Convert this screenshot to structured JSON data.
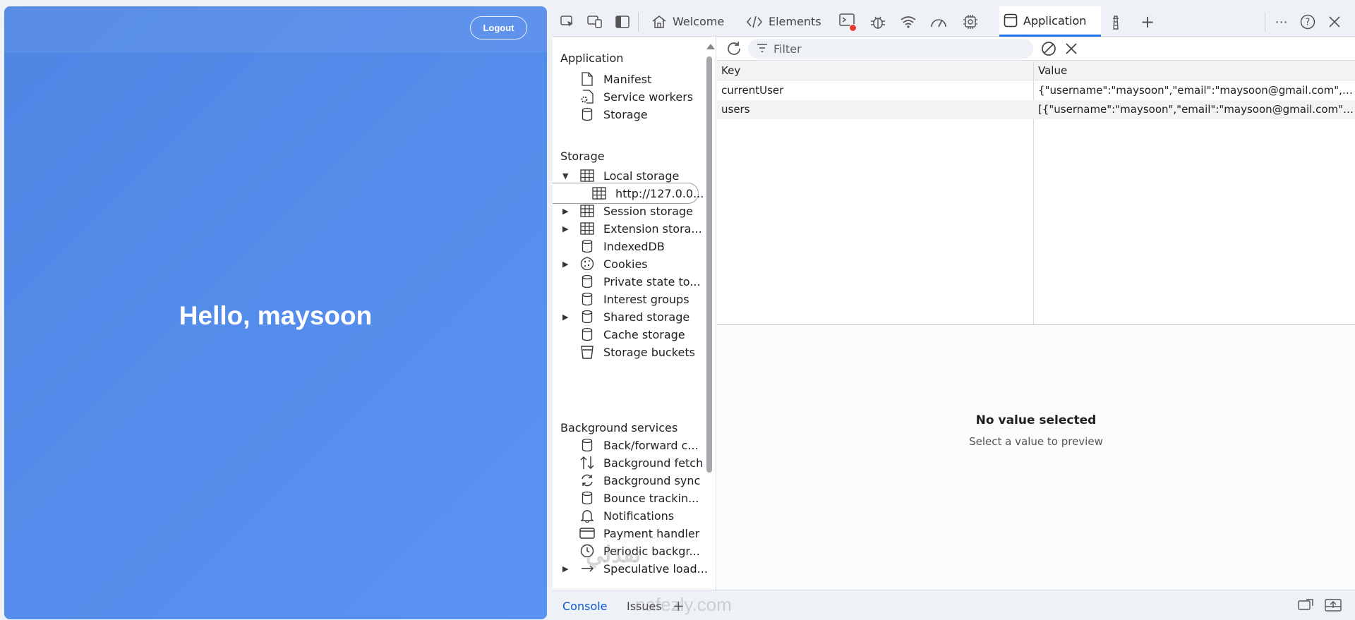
{
  "webpage": {
    "logout_label": "Logout",
    "greeting": "Hello, maysoon"
  },
  "devtools": {
    "tabs": [
      {
        "label": "Welcome",
        "icon": "home-icon"
      },
      {
        "label": "Elements",
        "icon": "code-icon"
      },
      {
        "label": "Application",
        "icon": "window-icon",
        "active": true
      }
    ],
    "toolbar_icons": [
      "inspect-icon",
      "device-toggle-icon",
      "dock-side-icon",
      "console-icon",
      "bug-icon",
      "wifi-icon",
      "performance-icon",
      "memory-icon",
      "lighthouse-icon",
      "add-tab-icon",
      "more-icon",
      "help-icon",
      "close-icon"
    ],
    "sidebar": {
      "application_header": "Application",
      "application_items": [
        "Manifest",
        "Service workers",
        "Storage"
      ],
      "storage_header": "Storage",
      "storage_items": [
        "Local storage",
        "http://127.0.0...",
        "Session storage",
        "Extension stora...",
        "IndexedDB",
        "Cookies",
        "Private state to...",
        "Interest groups",
        "Shared storage",
        "Cache storage",
        "Storage buckets"
      ],
      "background_header": "Background services",
      "background_items": [
        "Back/forward c...",
        "Background fetch",
        "Background sync",
        "Bounce trackin...",
        "Notifications",
        "Payment handler",
        "Periodic backgr...",
        "Speculative load..."
      ]
    },
    "filter": {
      "placeholder": "Filter"
    },
    "table": {
      "columns": [
        "Key",
        "Value"
      ],
      "rows": [
        {
          "key": "currentUser",
          "value": "{\"username\":\"maysoon\",\"email\":\"maysoon@gmail.com\",\"..."
        },
        {
          "key": "users",
          "value": "[{\"username\":\"maysoon\",\"email\":\"maysoon@gmail.com\",\"..."
        }
      ]
    },
    "preview": {
      "title": "No value selected",
      "subtitle": "Select a value to preview"
    },
    "drawer": {
      "tabs": [
        "Console",
        "Issues"
      ]
    }
  },
  "watermark": {
    "line1": "نفذلي",
    "line2": "nafezly.com"
  },
  "colors": {
    "page_bg": "#5a93f2",
    "accent": "#1a73e8",
    "devtools_bg": "#eef1f6"
  }
}
